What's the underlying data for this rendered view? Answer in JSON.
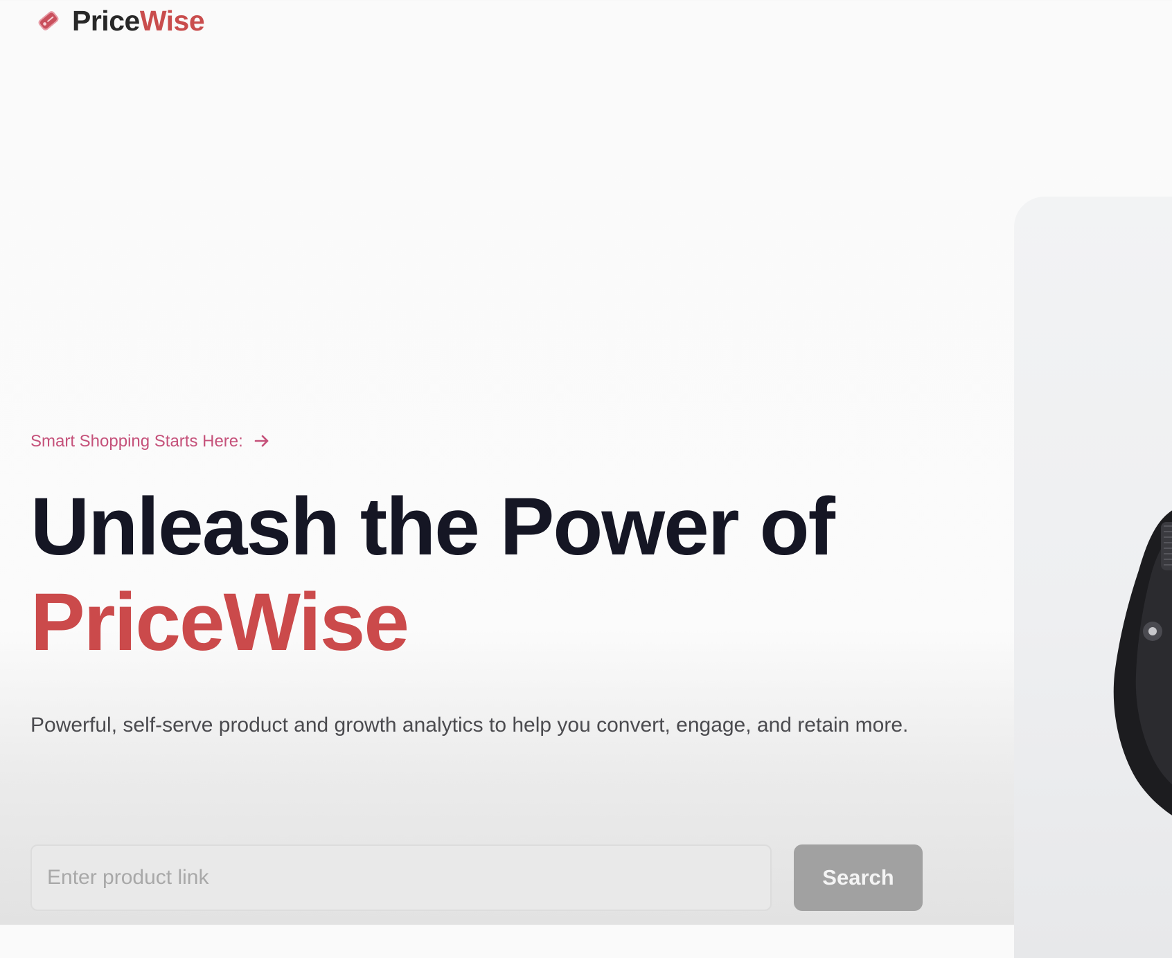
{
  "navbar": {
    "logo_part1": "Price",
    "logo_part2": "Wise"
  },
  "hero": {
    "tagline": "Smart Shopping Starts Here:",
    "headline_line1": "Unleash the Power of",
    "headline_accent": "PriceWise",
    "subtitle": "Powerful, self-serve product and growth analytics to help you convert, engage, and retain more."
  },
  "search": {
    "placeholder": "Enter product link",
    "button_label": "Search"
  },
  "icons": {
    "logo": "price-tag-icon",
    "tagline_arrow": "arrow-right-icon"
  },
  "colors": {
    "brand_red": "#cb4a4b",
    "tagline_pink": "#c5517a",
    "headline_dark": "#151624",
    "button_gray": "#a1a1a1"
  }
}
